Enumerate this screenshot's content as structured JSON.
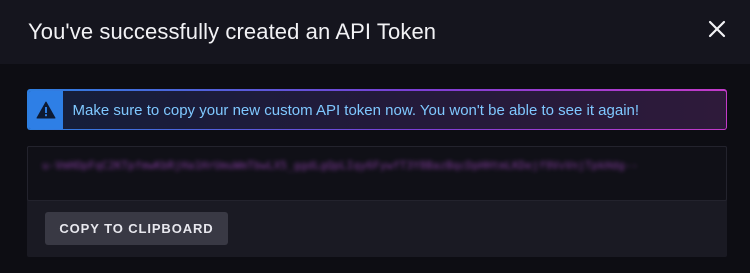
{
  "dialog": {
    "title": "You've successfully created an API Token",
    "close_icon": "close-icon"
  },
  "alert": {
    "icon": "warning-triangle-icon",
    "message": "Make sure to copy your new custom API token now. You won't be able to see it again!",
    "colors": {
      "icon_bg": "#2e7fe6",
      "text": "#7fc8ff",
      "border_start": "#2d7fe0",
      "border_end": "#c33ac9"
    }
  },
  "token": {
    "value": "u-VmHOpFqC2KTpfmwKbRjHa1HrUmuWmTbwLX5_ggdLgQpLIqy6FywfT3Y8BazBqcDpHHtmLKDejf9VvVnjTpkHdg--",
    "obscured": true
  },
  "copy_button": {
    "label": "COPY TO CLIPBOARD"
  }
}
